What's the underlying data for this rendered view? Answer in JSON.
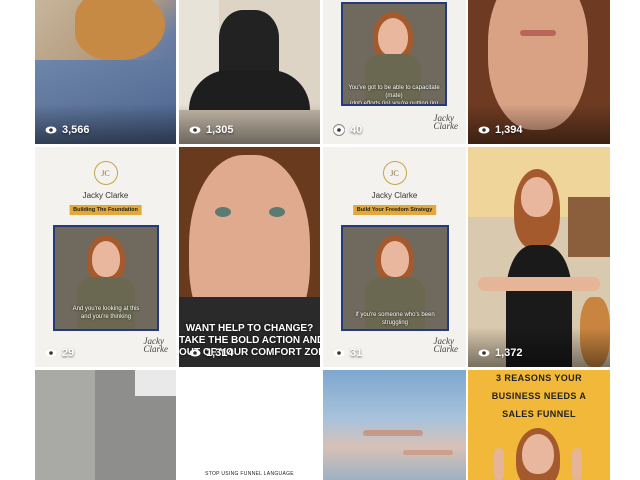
{
  "tiles": {
    "dog": {
      "views": "3,566"
    },
    "meditate": {
      "views": "1,305"
    },
    "subtitle_post": {
      "views": "40",
      "subtitle": "You've got to be able to capacitate (mate)\n(dot) efforts (in) you're putting (in)",
      "signature": "Jacky\nClarke"
    },
    "closeup": {
      "views": "1,394"
    },
    "foundation": {
      "name": "Jacky Clarke",
      "tag": "Building The Foundation",
      "subtitle": "And you're looking at this\nand you're thinking",
      "views": "29",
      "signature": "Jacky\nClarke"
    },
    "change": {
      "headline": "WANT HELP TO CHANGE?\nTAKE THE BOLD ACTION AND G\nOUT OF YOUR COMFORT ZONE?",
      "views": "1,314"
    },
    "freedom": {
      "name": "Jacky Clarke",
      "tag": "Build Your Freedom Strategy",
      "subtitle": "If you're someone who's been struggling",
      "views": "31",
      "signature": "Jacky\nClarke"
    },
    "namaste": {
      "views": "1,372"
    },
    "sidewalk": {},
    "funnel_lang": {
      "caption": "STOP USING FUNNEL LANGUAGE"
    },
    "sky": {},
    "reasons": {
      "headline_1": "3 REASONS YOUR",
      "headline_2": "BUSINESS NEEDS A",
      "headline_3": "SALES FUNNEL"
    }
  },
  "colors": {
    "accent_gold": "#e2a93a",
    "frame_blue": "#243a7a",
    "funnel_yellow": "#f1b83a"
  }
}
